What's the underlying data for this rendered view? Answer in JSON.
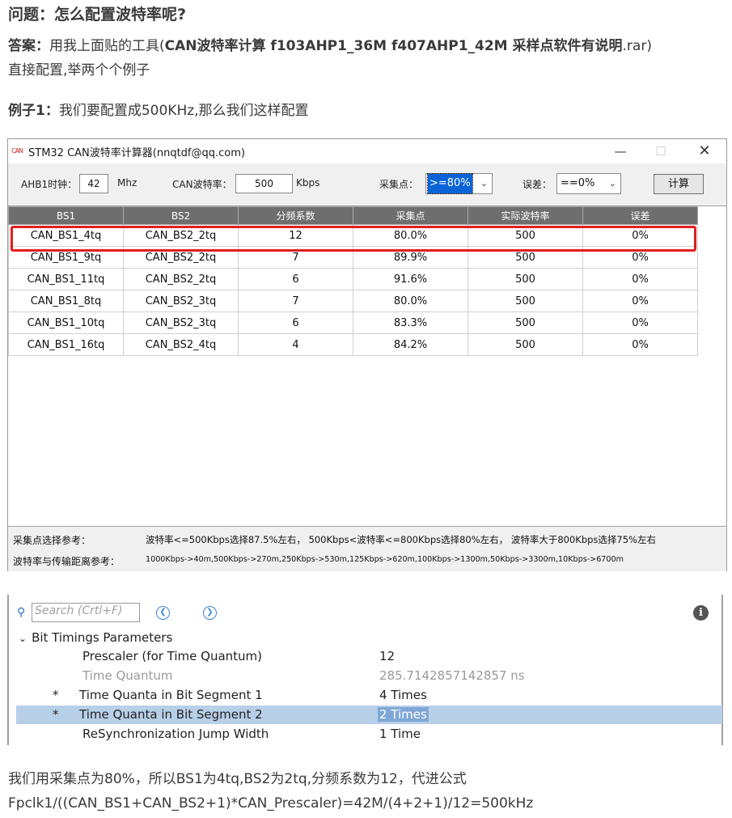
{
  "question": "问题：怎么配置波特率呢?",
  "answer": {
    "label": "答案：",
    "text1": "用我上面贴的工具(",
    "bold": "CAN波特率计算 f103AHP1_36M  f407AHP1_42M  采样点软件有说明",
    "text2": ".rar)",
    "line2": "直接配置,举两个个例子"
  },
  "example1": {
    "label": "例子1：",
    "text": "我们要配置成500KHz,那么我们这样配置"
  },
  "calculator": {
    "title": "STM32 CAN波特率计算器(nnqtdf@qq.com)",
    "logo": "CAN",
    "toolbar": {
      "ahb_label": "AHB1时钟：",
      "ahb_value": "42",
      "ahb_unit": "Mhz",
      "baud_label": "CAN波特率：",
      "baud_value": "500",
      "baud_unit": "Kbps",
      "sample_label": "采集点：",
      "sample_value": ">=80%",
      "error_label": "误差：",
      "error_value": "==0%",
      "calc_button": "计算"
    },
    "columns": [
      "BS1",
      "BS2",
      "分频系数",
      "采集点",
      "实际波特率",
      "误差"
    ],
    "rows": [
      [
        "CAN_BS1_4tq",
        "CAN_BS2_2tq",
        "12",
        "80.0%",
        "500",
        "0%"
      ],
      [
        "CAN_BS1_9tq",
        "CAN_BS2_2tq",
        "7",
        "89.9%",
        "500",
        "0%"
      ],
      [
        "CAN_BS1_11tq",
        "CAN_BS2_2tq",
        "6",
        "91.6%",
        "500",
        "0%"
      ],
      [
        "CAN_BS1_8tq",
        "CAN_BS2_3tq",
        "7",
        "80.0%",
        "500",
        "0%"
      ],
      [
        "CAN_BS1_10tq",
        "CAN_BS2_3tq",
        "6",
        "83.3%",
        "500",
        "0%"
      ],
      [
        "CAN_BS1_16tq",
        "CAN_BS2_4tq",
        "4",
        "84.2%",
        "500",
        "0%"
      ]
    ],
    "footer": {
      "ref1_label": "采集点选择参考：",
      "ref1_text": "波特率<=500Kbps选择87.5%左右，  500Kbps<波特率<=800Kbps选择80%左右，  波特率大于800Kbps选择75%左右",
      "ref2_label": "波特率与传输距离参考：",
      "ref2_text": "1000Kbps->40m,500Kbps->270m,250Kbps->530m,125Kbps->620m,100Kbps->1300m,50Kbps->3300m,10Kbps->6700m"
    }
  },
  "params": {
    "search_placeholder": "Search (Crtl+F)",
    "group": "Bit Timings Parameters",
    "items": [
      {
        "star": "",
        "name": "Prescaler (for Time Quantum)",
        "value": "12"
      },
      {
        "star": "",
        "name": "Time Quantum",
        "value": "285.7142857142857 ns"
      },
      {
        "star": "*",
        "name": "Time Quanta in Bit Segment 1",
        "value": "4 Times"
      },
      {
        "star": "*",
        "name": "Time Quanta in Bit Segment 2",
        "value": "2 Times"
      },
      {
        "star": "",
        "name": "ReSynchronization Jump Width",
        "value": "1 Time"
      }
    ]
  },
  "conclusion": {
    "line1": "我们用采集点为80%，所以BS1为4tq,BS2为2tq,分频系数为12，代进公式",
    "line2": "Fpclk1/((CAN_BS1+CAN_BS2+1)*CAN_Prescaler)=42M/(4+2+1)/12=500kHz"
  }
}
